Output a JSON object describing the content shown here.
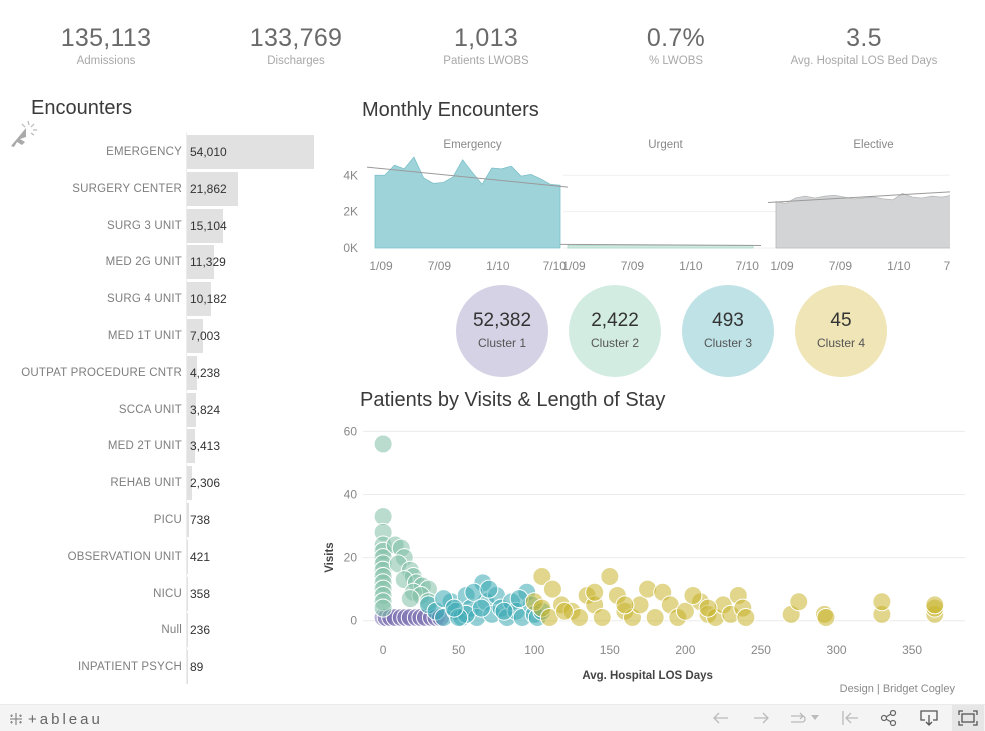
{
  "kpis": [
    {
      "value": "135,113",
      "label": "Admissions"
    },
    {
      "value": "133,769",
      "label": "Discharges"
    },
    {
      "value": "1,013",
      "label": "Patients LWOBS"
    },
    {
      "value": "0.7%",
      "label": "% LWOBS"
    },
    {
      "value": "3.5",
      "label": "Avg. Hospital LOS Bed Days"
    }
  ],
  "titles": {
    "encounters": "Encounters",
    "monthly": "Monthly Encounters",
    "scatter": "Patients by Visits & Length of Stay"
  },
  "colors": {
    "emergency": "#9fd3da",
    "urgent": "#cfe9e0",
    "elective": "#d3d4d5",
    "cluster1": "#d5d2e5",
    "cluster2": "#d3ece2",
    "cluster3": "#bfe2e6",
    "cluster4": "#efe5b6",
    "bar": "#e1e1e1"
  },
  "clusters": [
    {
      "value": "52,382",
      "label": "Cluster 1"
    },
    {
      "value": "2,422",
      "label": "Cluster 2"
    },
    {
      "value": "493",
      "label": "Cluster 3"
    },
    {
      "value": "45",
      "label": "Cluster 4"
    }
  ],
  "credit": "Design | Bridget Cogley",
  "footer": {
    "logo_text": "+ableau",
    "buttons": [
      "undo",
      "redo",
      "revert",
      "revert-menu",
      "reset",
      "share",
      "download",
      "fullscreen"
    ]
  },
  "chart_data": [
    {
      "type": "bar",
      "title": "Encounters",
      "orientation": "horizontal",
      "categories": [
        "EMERGENCY",
        "SURGERY CENTER",
        "SURG 3 UNIT",
        "MED 2G UNIT",
        "SURG 4 UNIT",
        "MED 1T UNIT",
        "OUTPAT PROCEDURE CNTR",
        "SCCA UNIT",
        "MED 2T UNIT",
        "REHAB UNIT",
        "PICU",
        "OBSERVATION UNIT",
        "NICU",
        "Null",
        "INPATIENT PSYCH"
      ],
      "values": [
        54010,
        21862,
        15104,
        11329,
        10182,
        7003,
        4238,
        3824,
        3413,
        2306,
        738,
        421,
        358,
        236,
        89
      ],
      "labels": [
        "54,010",
        "21,862",
        "15,104",
        "11,329",
        "10,182",
        "7,003",
        "4,238",
        "3,824",
        "3,413",
        "2,306",
        "738",
        "421",
        "358",
        "236",
        "89"
      ]
    },
    {
      "type": "area",
      "title": "Monthly Encounters",
      "ylim": [
        0,
        5500
      ],
      "yticks": [
        "0K",
        "2K",
        "4K"
      ],
      "yticks_values": [
        0,
        2000,
        4000
      ],
      "xticks": [
        "1/09",
        "7/09",
        "1/10",
        "7/10"
      ],
      "x": [
        "1/09",
        "2/09",
        "3/09",
        "4/09",
        "5/09",
        "6/09",
        "7/09",
        "8/09",
        "9/09",
        "10/09",
        "11/09",
        "12/09",
        "1/10",
        "2/10",
        "3/10",
        "4/10",
        "5/10",
        "6/10",
        "7/10",
        "8/10"
      ],
      "panels": [
        {
          "name": "Emergency",
          "values": [
            4000,
            4000,
            4550,
            4350,
            5000,
            3850,
            3550,
            3600,
            3900,
            4850,
            4150,
            3500,
            4400,
            4350,
            4500,
            3950,
            4050,
            3800,
            3500,
            3450
          ],
          "trend": [
            4450,
            3350
          ]
        },
        {
          "name": "Urgent",
          "values": [
            150,
            150,
            150,
            150,
            160,
            160,
            150,
            150,
            150,
            150,
            150,
            150,
            160,
            150,
            150,
            150,
            150,
            150,
            150,
            150
          ],
          "trend": [
            200,
            140
          ]
        },
        {
          "name": "Elective",
          "values": [
            2550,
            2450,
            2750,
            2850,
            2750,
            2850,
            2900,
            2800,
            2700,
            2750,
            2800,
            2700,
            2650,
            3000,
            2800,
            2750,
            2850,
            2800,
            2900,
            3050
          ],
          "trend": [
            2500,
            3150
          ]
        }
      ]
    },
    {
      "type": "scatter",
      "title": "Patients by Visits & Length of Stay",
      "xlabel": "Avg. Hospital LOS Days",
      "ylabel": "Visits",
      "xlim": [
        -10,
        385
      ],
      "ylim": [
        -2,
        62
      ],
      "xticks": [
        0,
        50,
        100,
        150,
        200,
        250,
        300,
        350
      ],
      "yticks": [
        0,
        20,
        40,
        60
      ],
      "grid": true,
      "series": [
        {
          "name": "Cluster 1",
          "color": "#7a6fb0",
          "points": [
            [
              0,
              1
            ],
            [
              2,
              1
            ],
            [
              5,
              1
            ],
            [
              8,
              1
            ],
            [
              12,
              1
            ],
            [
              15,
              1
            ],
            [
              18,
              1
            ],
            [
              22,
              1
            ],
            [
              25,
              1
            ],
            [
              28,
              1
            ],
            [
              32,
              1
            ],
            [
              35,
              1
            ],
            [
              38,
              1
            ]
          ]
        },
        {
          "name": "Cluster 2",
          "color": "#7fbfa6",
          "points": [
            [
              0,
              56
            ],
            [
              0,
              33
            ],
            [
              0,
              28
            ],
            [
              0,
              24
            ],
            [
              0,
              22
            ],
            [
              0,
              20
            ],
            [
              0,
              18
            ],
            [
              0,
              16
            ],
            [
              0,
              14
            ],
            [
              0,
              12
            ],
            [
              0,
              10
            ],
            [
              0,
              8
            ],
            [
              0,
              6
            ],
            [
              0,
              4
            ],
            [
              8,
              24
            ],
            [
              12,
              23
            ],
            [
              14,
              20
            ],
            [
              10,
              18
            ],
            [
              18,
              16
            ],
            [
              20,
              14
            ],
            [
              14,
              13
            ],
            [
              22,
              12
            ],
            [
              26,
              11
            ],
            [
              30,
              10
            ],
            [
              20,
              9
            ],
            [
              25,
              8
            ],
            [
              18,
              7
            ],
            [
              30,
              6
            ]
          ]
        },
        {
          "name": "Cluster 3",
          "color": "#3aa9b5",
          "points": [
            [
              30,
              5
            ],
            [
              35,
              3
            ],
            [
              40,
              1
            ],
            [
              45,
              6
            ],
            [
              48,
              3
            ],
            [
              52,
              1
            ],
            [
              55,
              8
            ],
            [
              58,
              4
            ],
            [
              62,
              1
            ],
            [
              66,
              12
            ],
            [
              68,
              6
            ],
            [
              72,
              2
            ],
            [
              75,
              8
            ],
            [
              78,
              4
            ],
            [
              82,
              1
            ],
            [
              85,
              6
            ],
            [
              88,
              3
            ],
            [
              92,
              1
            ],
            [
              95,
              9
            ],
            [
              98,
              5
            ],
            [
              100,
              2
            ],
            [
              102,
              1
            ],
            [
              60,
              9
            ],
            [
              40,
              7
            ],
            [
              70,
              10
            ],
            [
              90,
              7
            ],
            [
              55,
              2
            ],
            [
              65,
              4
            ],
            [
              80,
              3
            ],
            [
              105,
              3
            ],
            [
              50,
              1
            ],
            [
              47,
              4
            ]
          ]
        },
        {
          "name": "Cluster 4",
          "color": "#c8b42c",
          "points": [
            [
              100,
              6
            ],
            [
              105,
              4
            ],
            [
              110,
              1
            ],
            [
              105,
              14
            ],
            [
              112,
              10
            ],
            [
              118,
              5
            ],
            [
              125,
              3
            ],
            [
              130,
              1
            ],
            [
              135,
              8
            ],
            [
              140,
              5
            ],
            [
              145,
              1
            ],
            [
              150,
              14
            ],
            [
              155,
              8
            ],
            [
              160,
              3
            ],
            [
              165,
              1
            ],
            [
              170,
              5
            ],
            [
              175,
              10
            ],
            [
              180,
              1
            ],
            [
              185,
              9
            ],
            [
              190,
              5
            ],
            [
              195,
              1
            ],
            [
              200,
              3
            ],
            [
              210,
              6
            ],
            [
              215,
              2
            ],
            [
              220,
              1
            ],
            [
              225,
              5
            ],
            [
              230,
              2
            ],
            [
              235,
              8
            ],
            [
              238,
              4
            ],
            [
              240,
              1
            ],
            [
              270,
              2
            ],
            [
              275,
              6
            ],
            [
              292,
              2
            ],
            [
              293,
              1
            ],
            [
              330,
              2
            ],
            [
              330,
              6
            ],
            [
              365,
              2
            ],
            [
              365,
              4
            ],
            [
              365,
              5
            ],
            [
              160,
              5
            ],
            [
              140,
              9
            ],
            [
              120,
              3
            ],
            [
              205,
              8
            ],
            [
              215,
              4
            ]
          ]
        }
      ]
    }
  ]
}
